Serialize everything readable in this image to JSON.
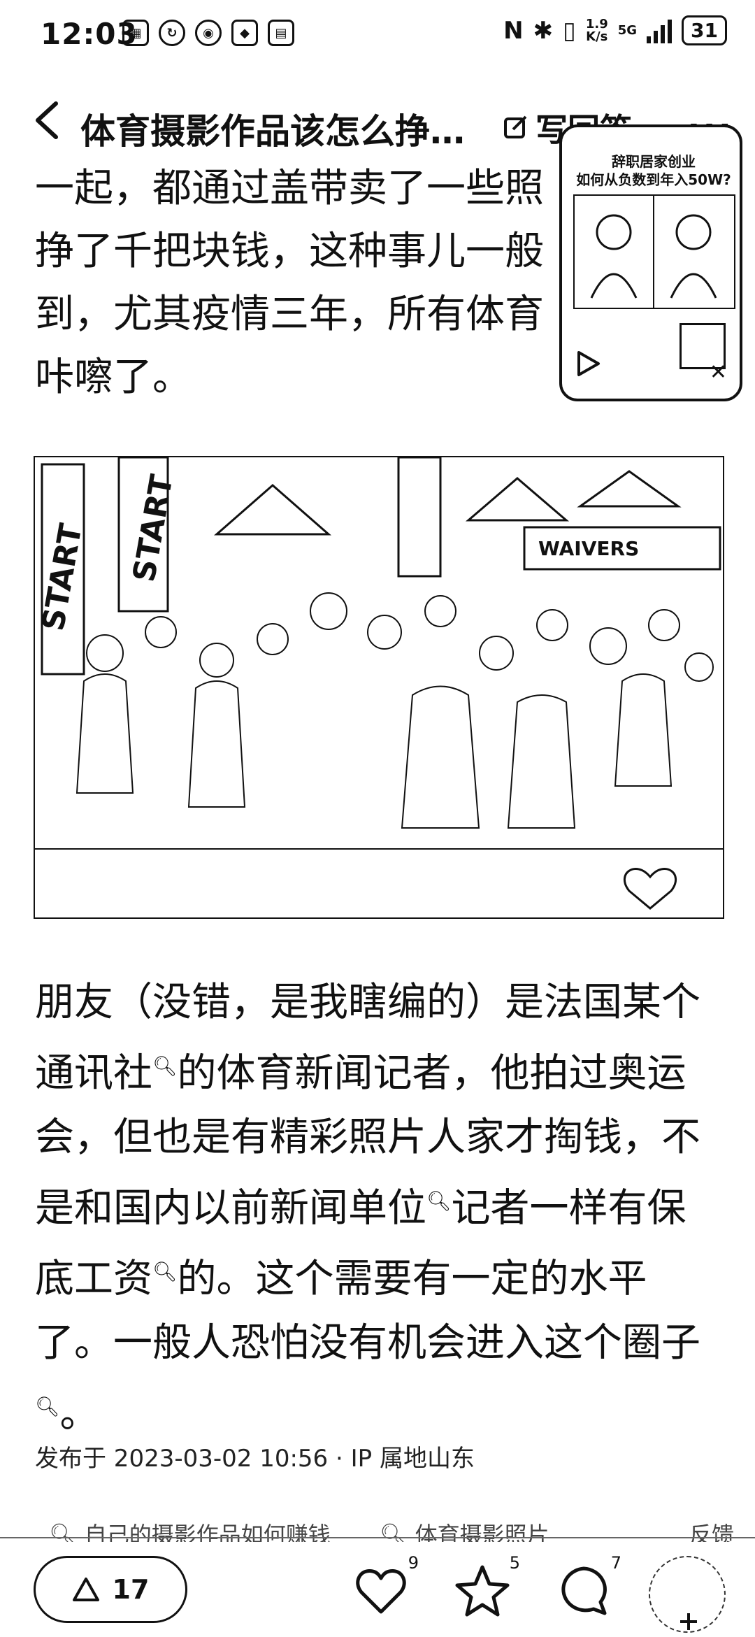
{
  "status_bar": {
    "time": "12:03",
    "icons": [
      "app-icon",
      "sync-icon",
      "weibo-icon",
      "app-icon",
      "app-icon"
    ],
    "net_speed_value": "1.9",
    "net_speed_unit": "K/s",
    "network": "5G",
    "battery": "31"
  },
  "header": {
    "title": "体育摄影作品该怎么挣…",
    "write_answer": "写回答",
    "more": "···"
  },
  "content": {
    "para1": "一起，都通过盖带卖了一些照 挣了千把块钱，这种事儿一般 到，尤其疫情三年，所有体育 咔嚓了。",
    "para2_a": "朋友（没错，是我瞎编的）是法国某个通讯社",
    "para2_b": "的体育新闻记者，他拍过奥运会，但也是有精彩照片人家才掏钱，不是和国内以前新闻单位",
    "para2_c": "记者一样有保底工资",
    "para2_d": "的。这个需要有一定的水平了。一般人恐怕没有机会进入这个圈子",
    "para2_e": "。",
    "photo_banners": [
      "START",
      "START",
      "WAIVERS"
    ]
  },
  "meta": {
    "published": "发布于 2023-03-02 10:56 · IP 属地山东"
  },
  "tags": [
    "自己的摄影作品如何赚钱",
    "体育摄影照片",
    "反馈"
  ],
  "bottom_bar": {
    "vote_count": "17",
    "like_count": "9",
    "favorite_count": "5",
    "comment_count": "7"
  },
  "floating_card": {
    "title_line1": "辞职居家创业",
    "title_line2": "如何从负数到年入50W?"
  }
}
